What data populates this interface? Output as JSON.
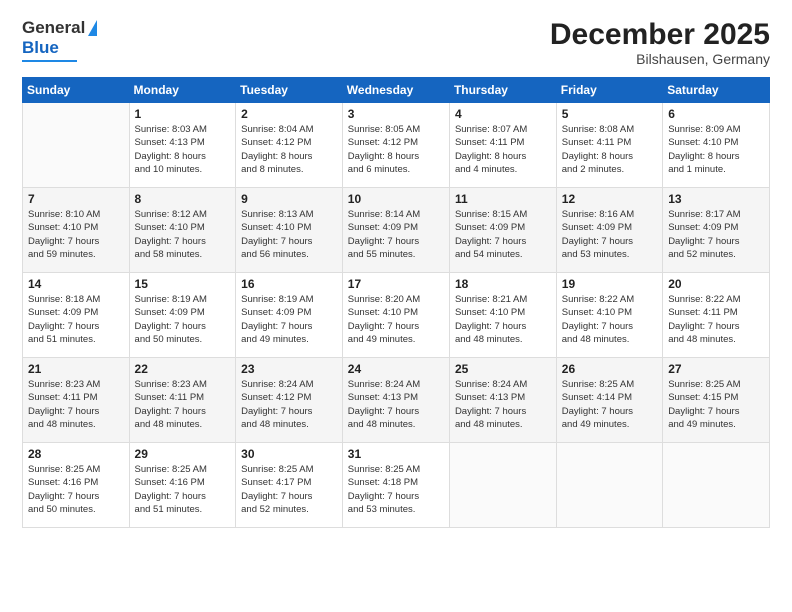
{
  "logo": {
    "line1": "General",
    "line2": "Blue"
  },
  "header": {
    "month": "December 2025",
    "location": "Bilshausen, Germany"
  },
  "weekdays": [
    "Sunday",
    "Monday",
    "Tuesday",
    "Wednesday",
    "Thursday",
    "Friday",
    "Saturday"
  ],
  "weeks": [
    [
      {
        "day": "",
        "info": ""
      },
      {
        "day": "1",
        "info": "Sunrise: 8:03 AM\nSunset: 4:13 PM\nDaylight: 8 hours\nand 10 minutes."
      },
      {
        "day": "2",
        "info": "Sunrise: 8:04 AM\nSunset: 4:12 PM\nDaylight: 8 hours\nand 8 minutes."
      },
      {
        "day": "3",
        "info": "Sunrise: 8:05 AM\nSunset: 4:12 PM\nDaylight: 8 hours\nand 6 minutes."
      },
      {
        "day": "4",
        "info": "Sunrise: 8:07 AM\nSunset: 4:11 PM\nDaylight: 8 hours\nand 4 minutes."
      },
      {
        "day": "5",
        "info": "Sunrise: 8:08 AM\nSunset: 4:11 PM\nDaylight: 8 hours\nand 2 minutes."
      },
      {
        "day": "6",
        "info": "Sunrise: 8:09 AM\nSunset: 4:10 PM\nDaylight: 8 hours\nand 1 minute."
      }
    ],
    [
      {
        "day": "7",
        "info": "Sunrise: 8:10 AM\nSunset: 4:10 PM\nDaylight: 7 hours\nand 59 minutes."
      },
      {
        "day": "8",
        "info": "Sunrise: 8:12 AM\nSunset: 4:10 PM\nDaylight: 7 hours\nand 58 minutes."
      },
      {
        "day": "9",
        "info": "Sunrise: 8:13 AM\nSunset: 4:10 PM\nDaylight: 7 hours\nand 56 minutes."
      },
      {
        "day": "10",
        "info": "Sunrise: 8:14 AM\nSunset: 4:09 PM\nDaylight: 7 hours\nand 55 minutes."
      },
      {
        "day": "11",
        "info": "Sunrise: 8:15 AM\nSunset: 4:09 PM\nDaylight: 7 hours\nand 54 minutes."
      },
      {
        "day": "12",
        "info": "Sunrise: 8:16 AM\nSunset: 4:09 PM\nDaylight: 7 hours\nand 53 minutes."
      },
      {
        "day": "13",
        "info": "Sunrise: 8:17 AM\nSunset: 4:09 PM\nDaylight: 7 hours\nand 52 minutes."
      }
    ],
    [
      {
        "day": "14",
        "info": "Sunrise: 8:18 AM\nSunset: 4:09 PM\nDaylight: 7 hours\nand 51 minutes."
      },
      {
        "day": "15",
        "info": "Sunrise: 8:19 AM\nSunset: 4:09 PM\nDaylight: 7 hours\nand 50 minutes."
      },
      {
        "day": "16",
        "info": "Sunrise: 8:19 AM\nSunset: 4:09 PM\nDaylight: 7 hours\nand 49 minutes."
      },
      {
        "day": "17",
        "info": "Sunrise: 8:20 AM\nSunset: 4:10 PM\nDaylight: 7 hours\nand 49 minutes."
      },
      {
        "day": "18",
        "info": "Sunrise: 8:21 AM\nSunset: 4:10 PM\nDaylight: 7 hours\nand 48 minutes."
      },
      {
        "day": "19",
        "info": "Sunrise: 8:22 AM\nSunset: 4:10 PM\nDaylight: 7 hours\nand 48 minutes."
      },
      {
        "day": "20",
        "info": "Sunrise: 8:22 AM\nSunset: 4:11 PM\nDaylight: 7 hours\nand 48 minutes."
      }
    ],
    [
      {
        "day": "21",
        "info": "Sunrise: 8:23 AM\nSunset: 4:11 PM\nDaylight: 7 hours\nand 48 minutes."
      },
      {
        "day": "22",
        "info": "Sunrise: 8:23 AM\nSunset: 4:11 PM\nDaylight: 7 hours\nand 48 minutes."
      },
      {
        "day": "23",
        "info": "Sunrise: 8:24 AM\nSunset: 4:12 PM\nDaylight: 7 hours\nand 48 minutes."
      },
      {
        "day": "24",
        "info": "Sunrise: 8:24 AM\nSunset: 4:13 PM\nDaylight: 7 hours\nand 48 minutes."
      },
      {
        "day": "25",
        "info": "Sunrise: 8:24 AM\nSunset: 4:13 PM\nDaylight: 7 hours\nand 48 minutes."
      },
      {
        "day": "26",
        "info": "Sunrise: 8:25 AM\nSunset: 4:14 PM\nDaylight: 7 hours\nand 49 minutes."
      },
      {
        "day": "27",
        "info": "Sunrise: 8:25 AM\nSunset: 4:15 PM\nDaylight: 7 hours\nand 49 minutes."
      }
    ],
    [
      {
        "day": "28",
        "info": "Sunrise: 8:25 AM\nSunset: 4:16 PM\nDaylight: 7 hours\nand 50 minutes."
      },
      {
        "day": "29",
        "info": "Sunrise: 8:25 AM\nSunset: 4:16 PM\nDaylight: 7 hours\nand 51 minutes."
      },
      {
        "day": "30",
        "info": "Sunrise: 8:25 AM\nSunset: 4:17 PM\nDaylight: 7 hours\nand 52 minutes."
      },
      {
        "day": "31",
        "info": "Sunrise: 8:25 AM\nSunset: 4:18 PM\nDaylight: 7 hours\nand 53 minutes."
      },
      {
        "day": "",
        "info": ""
      },
      {
        "day": "",
        "info": ""
      },
      {
        "day": "",
        "info": ""
      }
    ]
  ]
}
